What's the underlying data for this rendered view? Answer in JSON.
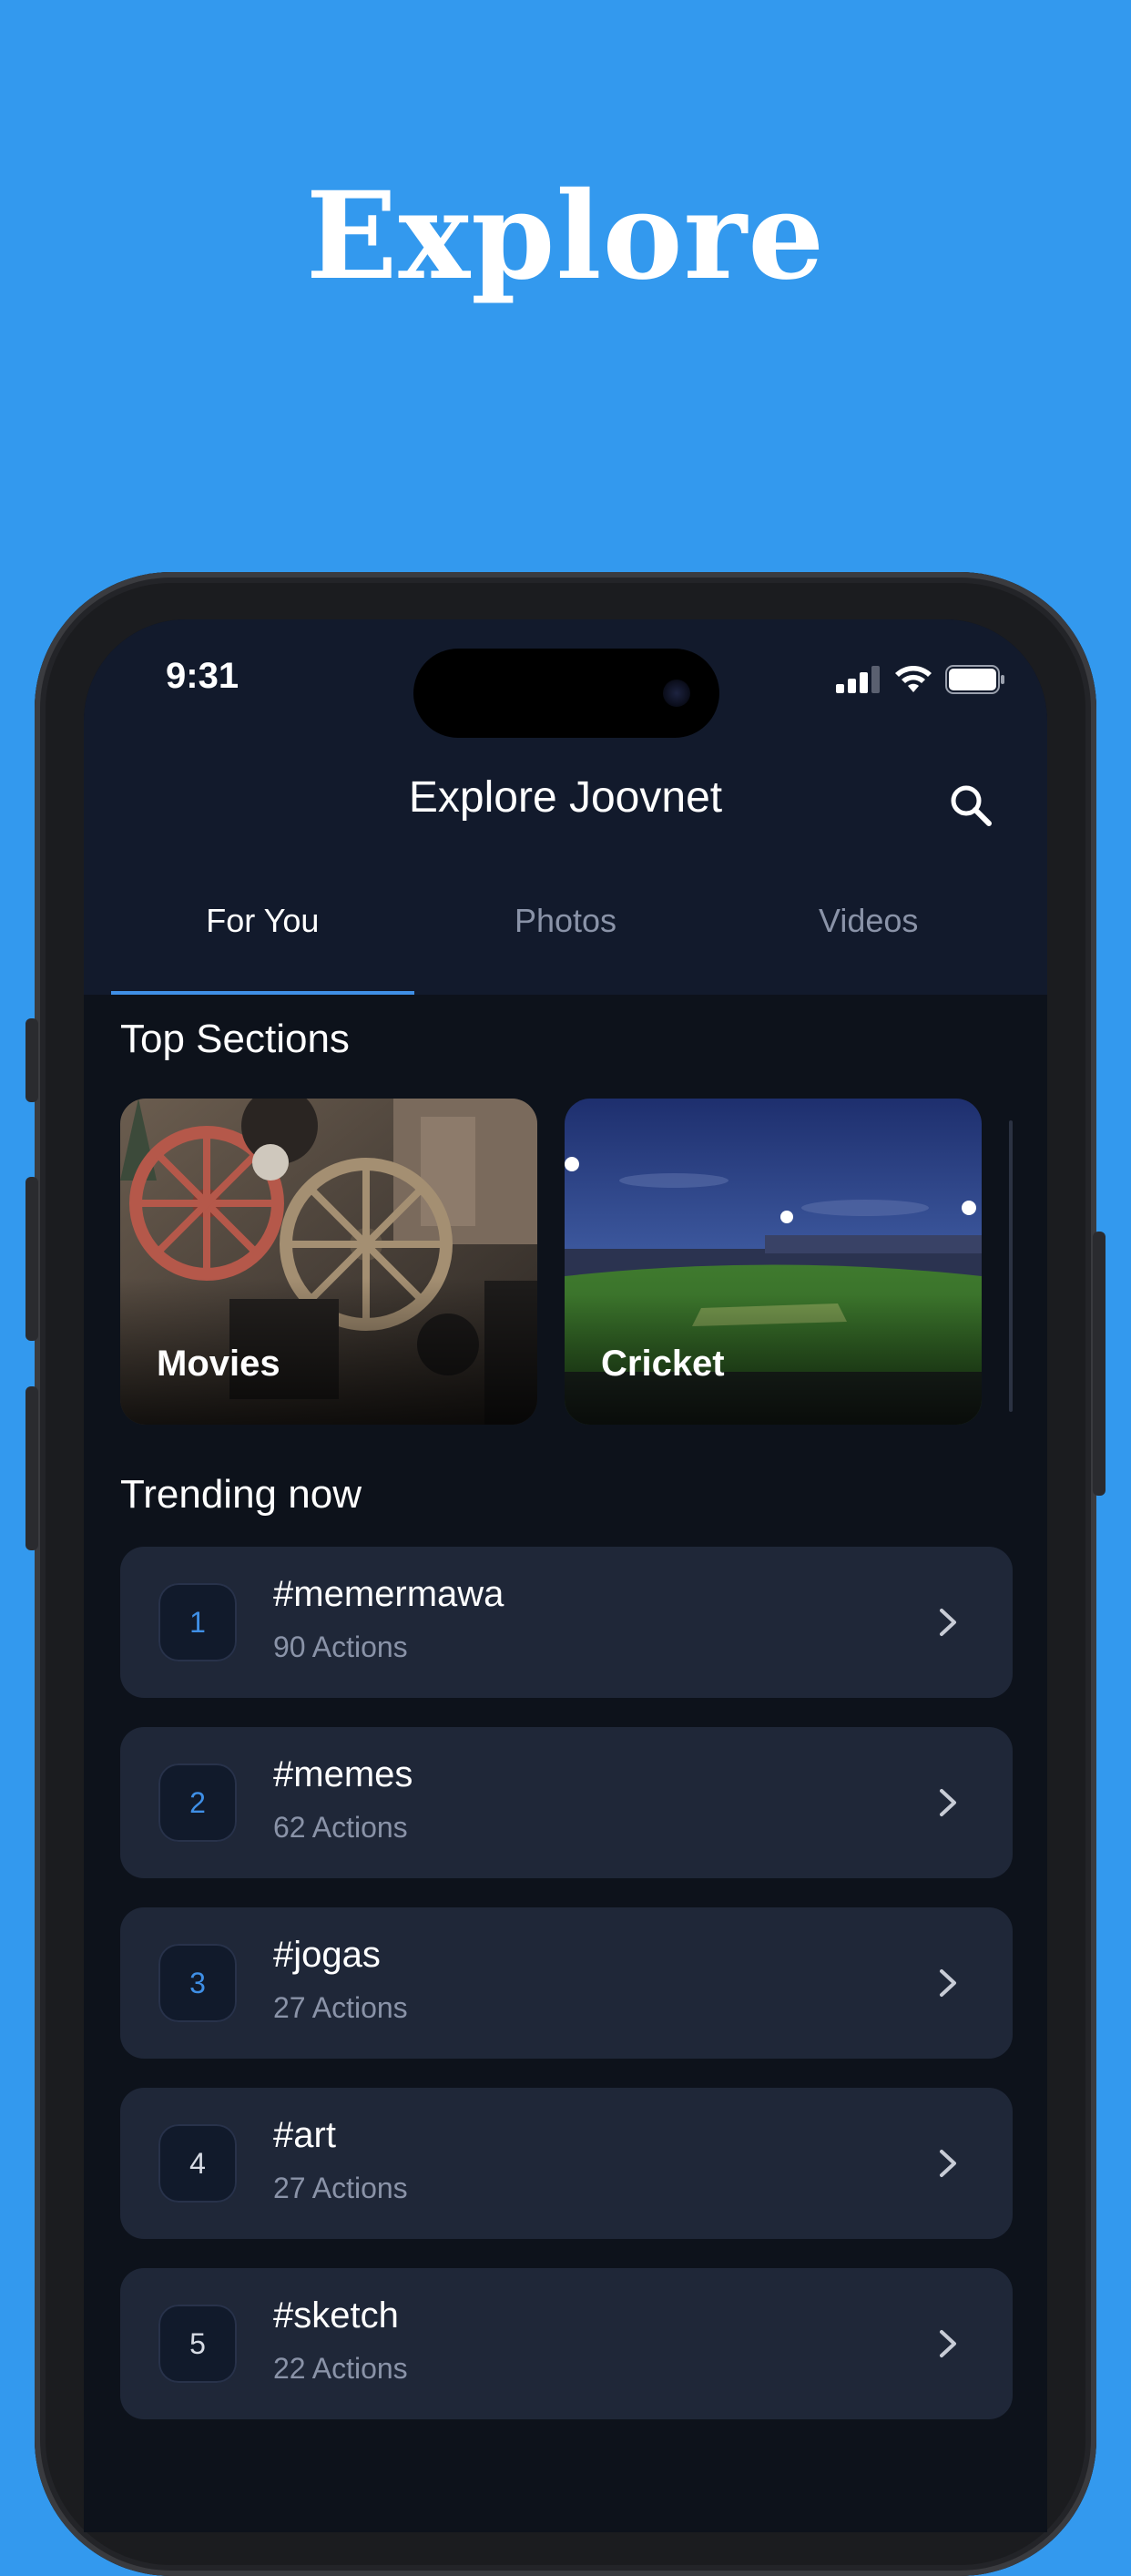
{
  "hero": {
    "title": "Explore"
  },
  "status_bar": {
    "time": "9:31",
    "signal_icon": "cellular-signal-icon",
    "wifi_icon": "wifi-icon",
    "battery_icon": "battery-icon"
  },
  "header": {
    "title": "Explore Joovnet",
    "search_icon": "search-icon"
  },
  "tabs": [
    {
      "label": "For You",
      "active": true
    },
    {
      "label": "Photos",
      "active": false
    },
    {
      "label": "Videos",
      "active": false
    }
  ],
  "top_sections": {
    "heading": "Top Sections",
    "cards": [
      {
        "label": "Movies"
      },
      {
        "label": "Cricket"
      }
    ]
  },
  "trending": {
    "heading": "Trending now",
    "items": [
      {
        "rank": "1",
        "tag": "#memermawa",
        "count": "90 Actions"
      },
      {
        "rank": "2",
        "tag": "#memes",
        "count": "62 Actions"
      },
      {
        "rank": "3",
        "tag": "#jogas",
        "count": "27 Actions"
      },
      {
        "rank": "4",
        "tag": "#art",
        "count": "27 Actions"
      },
      {
        "rank": "5",
        "tag": "#sketch",
        "count": "22 Actions"
      }
    ]
  },
  "colors": {
    "background": "#3399ee",
    "accent": "#3f8fe6",
    "surface": "#1f2738",
    "screen": "#0d121b"
  }
}
